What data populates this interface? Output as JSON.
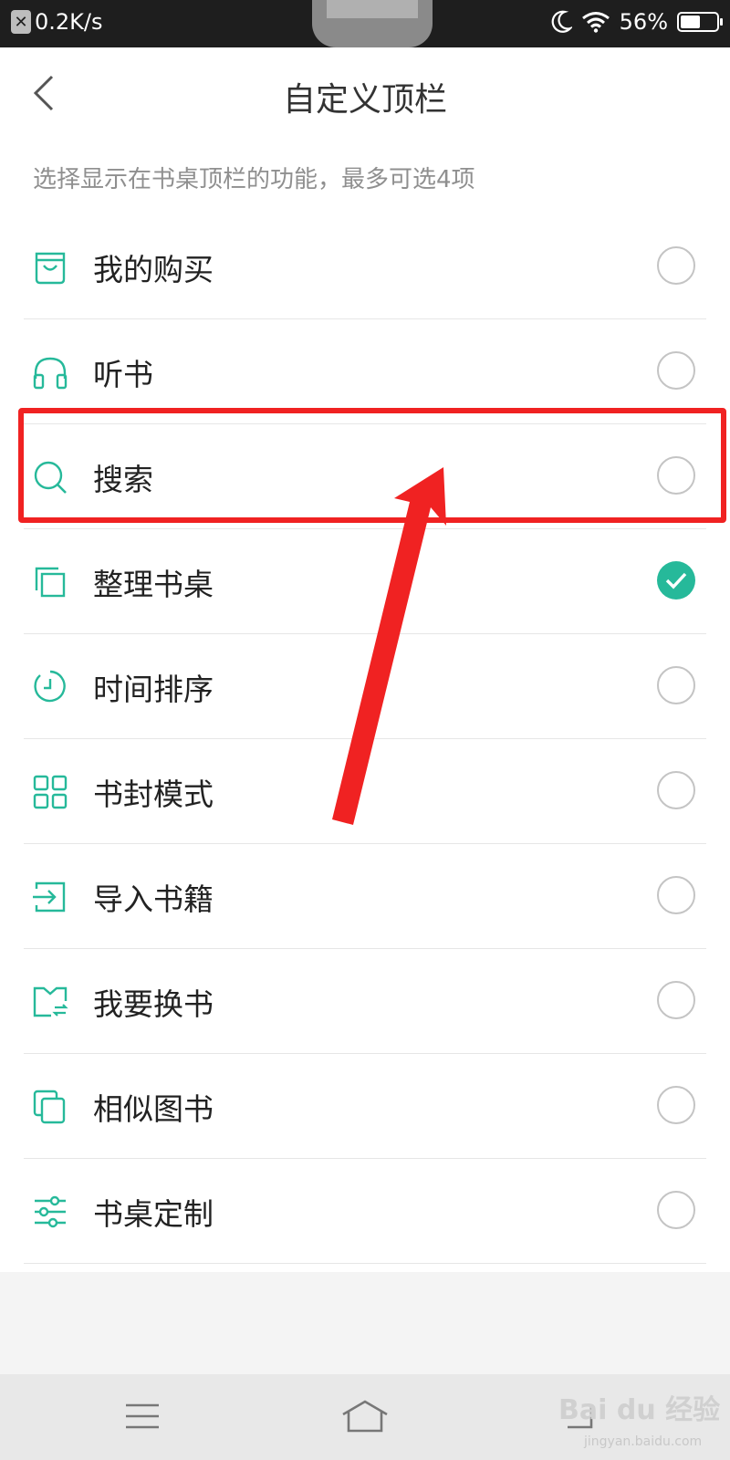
{
  "status_bar": {
    "net_badge": "✕",
    "net_speed": "0.2K/s",
    "battery_percent": "56%",
    "battery_level": 0.56
  },
  "header": {
    "title": "自定义顶栏"
  },
  "hint": "选择显示在书桌顶栏的功能，最多可选4项",
  "items": [
    {
      "label": "我的购买",
      "icon": "shopping-bag-icon",
      "checked": false
    },
    {
      "label": "听书",
      "icon": "headphones-icon",
      "checked": false
    },
    {
      "label": "搜索",
      "icon": "search-icon",
      "checked": false
    },
    {
      "label": "整理书桌",
      "icon": "copy-icon",
      "checked": true
    },
    {
      "label": "时间排序",
      "icon": "clock-icon",
      "checked": false
    },
    {
      "label": "书封模式",
      "icon": "grid-icon",
      "checked": false
    },
    {
      "label": "导入书籍",
      "icon": "import-icon",
      "checked": false
    },
    {
      "label": "我要换书",
      "icon": "book-swap-icon",
      "checked": false
    },
    {
      "label": "相似图书",
      "icon": "similar-books-icon",
      "checked": false
    },
    {
      "label": "书桌定制",
      "icon": "sliders-icon",
      "checked": false
    }
  ],
  "accent_color": "#26b99a",
  "highlight_color": "#f02222",
  "watermark": {
    "text": "Bai du 经验",
    "sub": "jingyan.baidu.com"
  }
}
